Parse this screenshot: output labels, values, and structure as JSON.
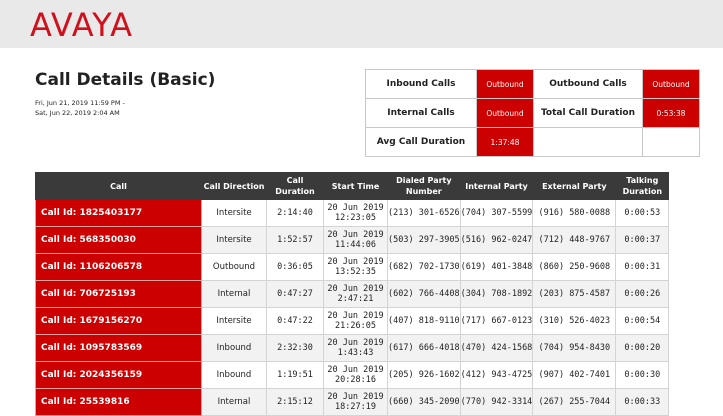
{
  "header": {
    "logo_text": "AVAYA",
    "brand_color": "#d0101c"
  },
  "report": {
    "title": "Call Details (Basic)",
    "date_from": "Fri, Jun 21, 2019 11:59 PM -",
    "date_to": "Sat, Jun 22, 2019 2:04 AM"
  },
  "summary": {
    "inbound_calls_label": "Inbound Calls",
    "inbound_calls_value": "Outbound",
    "outbound_calls_label": "Outbound Calls",
    "outbound_calls_value": "Outbound",
    "internal_calls_label": "Internal Calls",
    "internal_calls_value": "Outbound",
    "total_duration_label": "Total Call Duration",
    "total_duration_value": "0:53:38",
    "avg_duration_label": "Avg Call Duration",
    "avg_duration_value": "1:37:48"
  },
  "table": {
    "headers": [
      "Call",
      "Call Direction",
      "Call Duration",
      "Start Time",
      "Dialed Party Number",
      "Internal Party",
      "External Party",
      "Talking Duration"
    ],
    "rows": [
      [
        "Call Id: 1825403177",
        "Intersite",
        "2:14:40",
        "20 Jun 2019\n12:23:05",
        "(213) 301-6526",
        "(704) 307-5599",
        "(916) 580-0088",
        "0:00:53"
      ],
      [
        "Call Id: 568350030",
        "Intersite",
        "1:52:57",
        "20 Jun 2019\n11:44:06",
        "(503) 297-3905",
        "(516) 962-0247",
        "(712) 448-9767",
        "0:00:37"
      ],
      [
        "Call Id: 1106206578",
        "Outbound",
        "0:36:05",
        "20 Jun 2019\n13:52:35",
        "(682) 702-1730",
        "(619) 401-3848",
        "(860) 250-9608",
        "0:00:31"
      ],
      [
        "Call Id: 706725193",
        "Internal",
        "0:47:27",
        "20 Jun 2019\n2:47:21",
        "(602) 766-4408",
        "(304) 708-1892",
        "(203) 875-4587",
        "0:00:26"
      ],
      [
        "Call Id: 1679156270",
        "Intersite",
        "0:47:22",
        "20 Jun 2019\n21:26:05",
        "(407) 818-9110",
        "(717) 667-0123",
        "(310) 526-4023",
        "0:00:54"
      ],
      [
        "Call Id: 1095783569",
        "Inbound",
        "2:32:30",
        "20 Jun 2019\n1:43:43",
        "(617) 666-4018",
        "(470) 424-1568",
        "(704) 954-8430",
        "0:00:20"
      ],
      [
        "Call Id: 2024356159",
        "Inbound",
        "1:19:51",
        "20 Jun 2019\n20:28:16",
        "(205) 926-1602",
        "(412) 943-4725",
        "(907) 402-7401",
        "0:00:30"
      ],
      [
        "Call Id: 25539816",
        "Internal",
        "2:15:12",
        "20 Jun 2019\n18:27:19",
        "(660) 345-2090",
        "(770) 942-3314",
        "(267) 255-7044",
        "0:00:33"
      ]
    ]
  }
}
